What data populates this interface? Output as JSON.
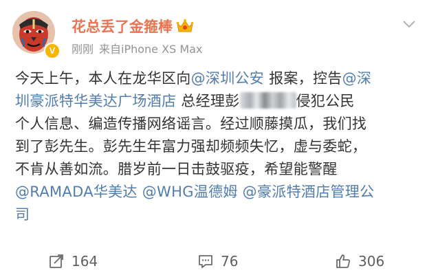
{
  "post": {
    "author": {
      "name": "花总丢了金箍棒",
      "badge_letter": "V",
      "avatar_icon": "opera-mask-avatar",
      "crown_icon": "crown-icon"
    },
    "meta": {
      "time": "刚刚",
      "source": "来自iPhone XS Max"
    },
    "content": {
      "line1": {
        "a": "今天上午，本人在龙华区向",
        "m1": "@深圳公安",
        "b": " 报案，控告",
        "m2": "@深"
      },
      "line2": {
        "m1": "圳豪派特华美达广场酒店",
        "a": " 总经理彭",
        "b": "侵犯公民"
      },
      "line3": "个人信息、编造传播网络谣言。经过顺藤摸瓜，我们找",
      "line4": "到了彭先生。彭先生年富力强却频频失忆，虚与委蛇，",
      "line5": "不肯从善如流。腊岁前一日击鼓驱疫，希望能警醒",
      "line6": {
        "m1": "@RAMADA华美达",
        "m2": "@WHG温德姆",
        "m3": "@豪派特酒店管理公"
      },
      "line7": {
        "m1": "司"
      }
    },
    "actions": {
      "repost_count": "164",
      "comment_count": "76",
      "like_count": "306"
    },
    "colors": {
      "username": "#eb7350",
      "mention": "#507daf",
      "meta": "#939393",
      "badge": "#f7b500"
    }
  }
}
